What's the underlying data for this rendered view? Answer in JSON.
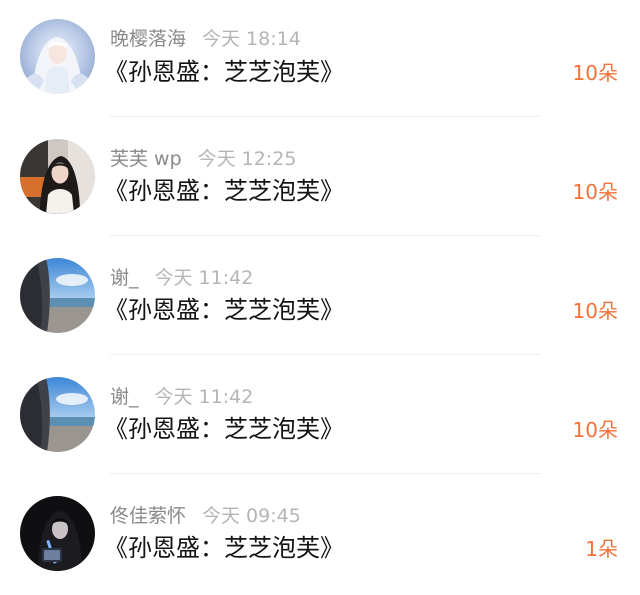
{
  "gift_list": [
    {
      "username": "晚樱落海",
      "time": "今天 18:14",
      "message": "《孙恩盛：芝芝泡芙》",
      "gift_count": "10朵",
      "avatar_icon": "anime-girl-white-hair-avatar-icon"
    },
    {
      "username": "芙芙 wp",
      "time": "今天 12:25",
      "message": "《孙恩盛：芝芝泡芙》",
      "gift_count": "10朵",
      "avatar_icon": "girl-in-car-avatar-icon"
    },
    {
      "username": "谢_",
      "time": "今天 11:42",
      "message": "《孙恩盛：芝芝泡芙》",
      "gift_count": "10朵",
      "avatar_icon": "beach-sky-avatar-icon"
    },
    {
      "username": "谢_",
      "time": "今天 11:42",
      "message": "《孙恩盛：芝芝泡芙》",
      "gift_count": "10朵",
      "avatar_icon": "beach-sky-avatar-icon"
    },
    {
      "username": "佟佳萦怀",
      "time": "今天 09:45",
      "message": "《孙恩盛：芝芝泡芙》",
      "gift_count": "1朵",
      "avatar_icon": "dark-portrait-avatar-icon"
    }
  ],
  "colors": {
    "count_accent": "#f5713a",
    "username": "#8a8a8a",
    "timestamp": "#b5b5b5",
    "message_text": "#141414"
  }
}
